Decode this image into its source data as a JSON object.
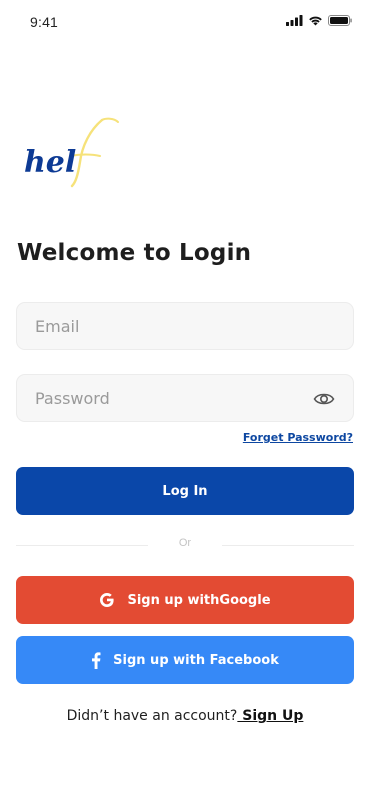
{
  "status_bar": {
    "time": "9:41"
  },
  "brand": {
    "logo_text": "hel",
    "logo_accent": "f",
    "primary_color": "#0a47a9",
    "accent_color": "#f6e27a"
  },
  "login": {
    "title": "Welcome to Login",
    "email_placeholder": "Email",
    "password_placeholder": "Password",
    "forgot_label": "Forget Password?",
    "login_button": "Log In",
    "divider_text": "Or",
    "google_button": "Sign up withGoogle",
    "facebook_button": "Sign up with Facebook",
    "signup_prompt": "Didn’t have an account?",
    "signup_link": " Sign Up"
  },
  "icons": {
    "password_toggle": "eye-icon",
    "google": "google-icon",
    "facebook": "facebook-icon",
    "signal": "signal-icon",
    "wifi": "wifi-icon",
    "battery": "battery-icon"
  },
  "colors": {
    "google": "#e34b33",
    "facebook": "#3689f7"
  }
}
